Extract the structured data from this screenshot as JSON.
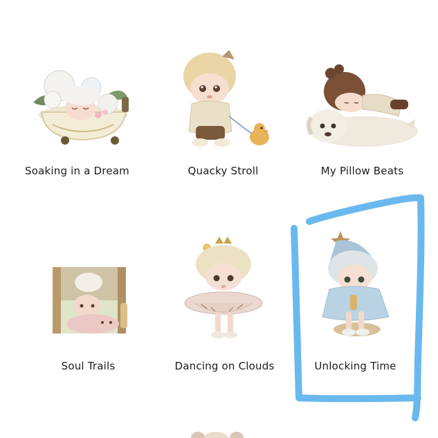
{
  "products": [
    {
      "title": "Soaking in a Dream"
    },
    {
      "title": "Quacky Stroll"
    },
    {
      "title": "My Pillow Beats"
    },
    {
      "title": "Soul Trails"
    },
    {
      "title": "Dancing on Clouds"
    },
    {
      "title": "Unlocking Time"
    }
  ],
  "colors": {
    "highlight_stroke": "#5ab1ec",
    "caption_text": "#1b1b1b",
    "background": "#ffffff"
  }
}
